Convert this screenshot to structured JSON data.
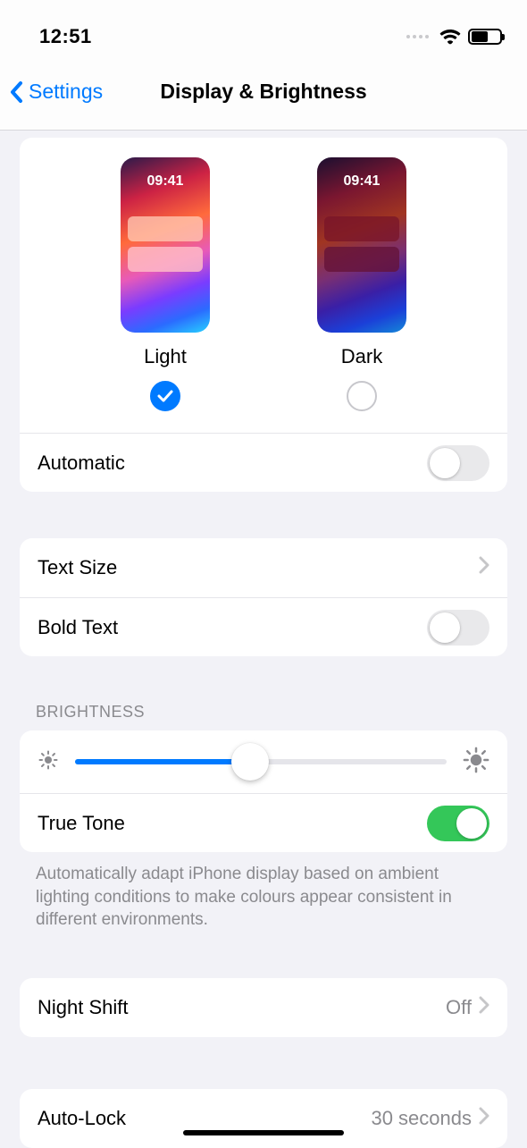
{
  "status": {
    "time": "12:51",
    "battery_pct": 60
  },
  "nav": {
    "back_label": "Settings",
    "title": "Display & Brightness"
  },
  "appearance": {
    "preview_time": "09:41",
    "options": [
      {
        "label": "Light",
        "selected": true
      },
      {
        "label": "Dark",
        "selected": false
      }
    ],
    "automatic": {
      "label": "Automatic",
      "on": false
    }
  },
  "text": {
    "text_size_label": "Text Size",
    "bold_text": {
      "label": "Bold Text",
      "on": false
    }
  },
  "brightness": {
    "header": "BRIGHTNESS",
    "value_pct": 47,
    "true_tone": {
      "label": "True Tone",
      "on": true
    },
    "footer": "Automatically adapt iPhone display based on ambient lighting conditions to make colours appear consistent in different environments."
  },
  "night_shift": {
    "label": "Night Shift",
    "value": "Off"
  },
  "auto_lock": {
    "label": "Auto-Lock",
    "value": "30 seconds"
  }
}
